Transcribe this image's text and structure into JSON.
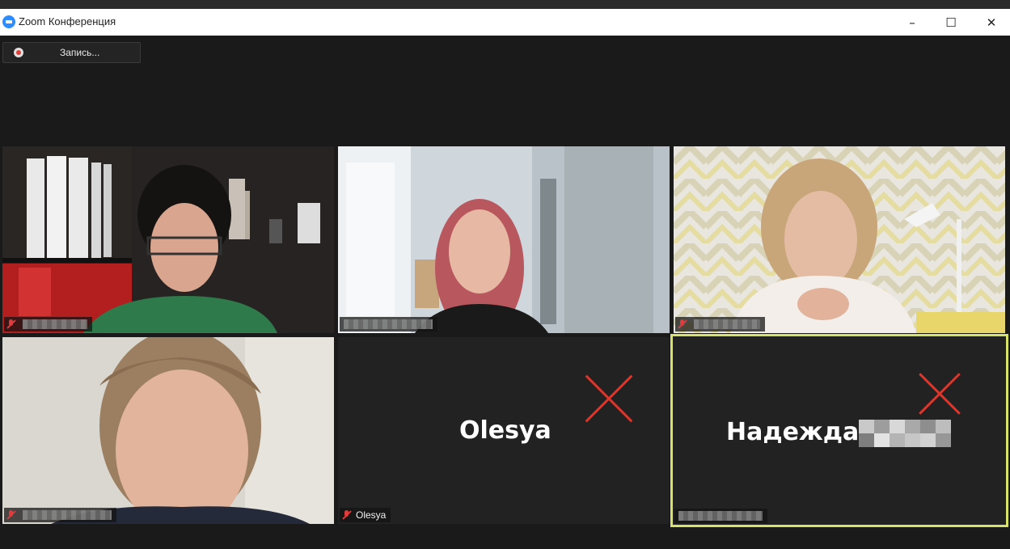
{
  "window": {
    "title": "Zoom Конференция",
    "controls": {
      "minimize": "–",
      "maximize": "☐",
      "close": "✕"
    }
  },
  "recording": {
    "label": "Запись..."
  },
  "participants": [
    {
      "name": "",
      "muted": true,
      "video": true
    },
    {
      "name": "",
      "muted": false,
      "video": true
    },
    {
      "name": "",
      "muted": true,
      "video": true
    },
    {
      "name": "",
      "muted": true,
      "video": true
    },
    {
      "name": "Olesya",
      "display_name": "Olesya",
      "muted": true,
      "video": false
    },
    {
      "name": "",
      "display_name": "Надежда",
      "muted": false,
      "video": false,
      "active_speaker": true
    }
  ],
  "colors": {
    "active_border": "#d6e26a",
    "muted_icon": "#e23b3b",
    "x_mark": "#e0352b",
    "zoom_blue": "#2d8cff"
  }
}
